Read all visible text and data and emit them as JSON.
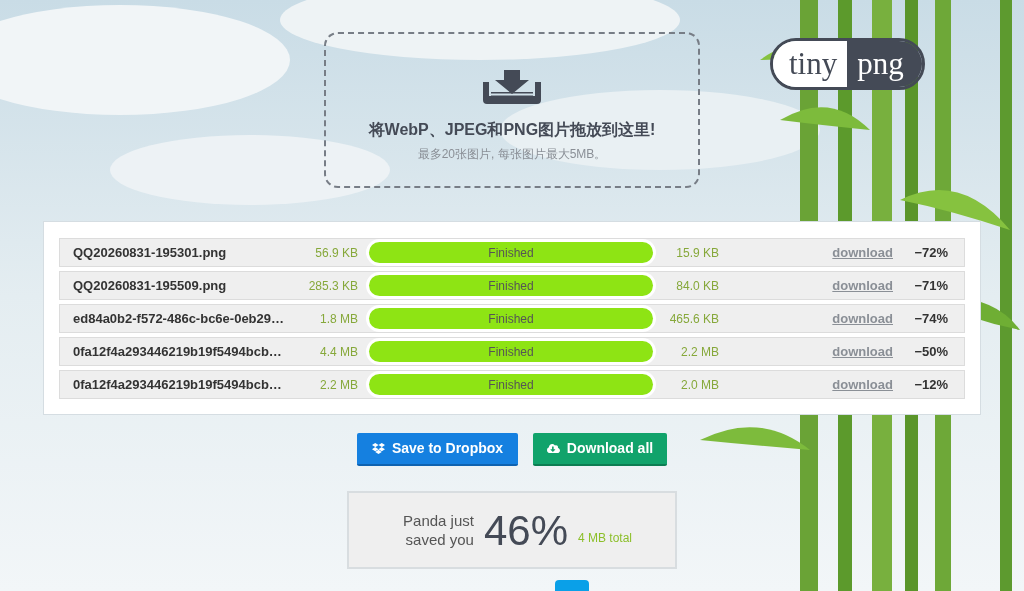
{
  "upload_area": {
    "title": "将WebP、JPEG和PNG图片拖放到这里!",
    "subtitle": "最多20张图片, 每张图片最大5MB。"
  },
  "logo": {
    "left": "tiny",
    "right": "png"
  },
  "files": [
    {
      "name": "QQ20260831-195301.png",
      "original_size": "56.9 KB",
      "status": "Finished",
      "level": 1,
      "compressed_size": "15.9 KB",
      "link": "download",
      "savings": "−72%"
    },
    {
      "name": "QQ20260831-195509.png",
      "original_size": "285.3 KB",
      "status": "Finished",
      "level": 1,
      "compressed_size": "84.0 KB",
      "link": "download",
      "savings": "−71%"
    },
    {
      "name": "ed84a0b2-f572-486c-bc6e-0eb29…",
      "original_size": "1.8 MB",
      "status": "Finished",
      "level": 1,
      "compressed_size": "465.6 KB",
      "link": "download",
      "savings": "−74%"
    },
    {
      "name": "0fa12f4a293446219b19f5494bcb…",
      "original_size": "4.4 MB",
      "status": "Finished",
      "level": 1,
      "compressed_size": "2.2 MB",
      "link": "download",
      "savings": "−50%"
    },
    {
      "name": "0fa12f4a293446219b19f5494bcb…",
      "original_size": "2.2 MB",
      "status": "Finished",
      "level": 1,
      "compressed_size": "2.0 MB",
      "link": "download",
      "savings": "−12%"
    }
  ],
  "buttons": [
    {
      "kind": "dropbox",
      "label": "Save to Dropbox"
    },
    {
      "kind": "download",
      "label": "Download all"
    }
  ],
  "summary": {
    "caption": "Panda just saved you",
    "percent": "46%",
    "total": "4 MB total"
  }
}
